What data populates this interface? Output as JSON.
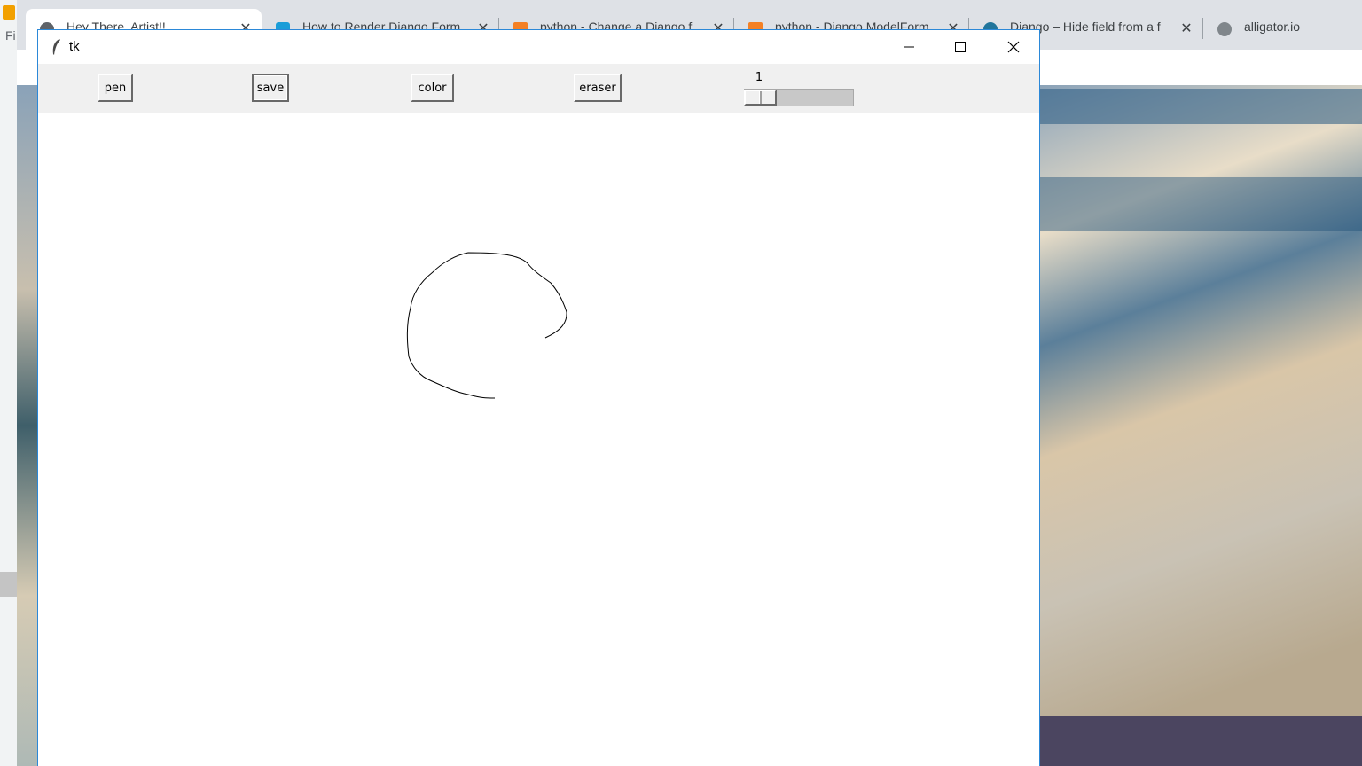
{
  "browser": {
    "left_strip_label": "Fi",
    "tabs": [
      {
        "title": "Hey There, Artist!!",
        "favicon": "globe-icon",
        "active": true
      },
      {
        "title": "How to Render Django Form",
        "favicon": "s-logo-icon",
        "active": false
      },
      {
        "title": "python - Change a Django f",
        "favicon": "stack-overflow-icon",
        "active": false
      },
      {
        "title": "python - Django ModelForm",
        "favicon": "stack-overflow-icon",
        "active": false
      },
      {
        "title": "Django – Hide field from a f",
        "favicon": "wordpress-icon",
        "active": false
      },
      {
        "title": "alligator.io",
        "favicon": "globe-icon",
        "active": false
      }
    ]
  },
  "window": {
    "title": "tk",
    "icon": "tk-feather-icon"
  },
  "toolbar": {
    "pen_label": "pen",
    "save_label": "save",
    "color_label": "color",
    "eraser_label": "eraser",
    "size_value": "1",
    "size_fraction": 0.0
  },
  "canvas": {
    "background": "#ffffff",
    "stroke_color": "#000000",
    "stroke_width": 1
  },
  "colors": {
    "window_border": "#2b88d8",
    "toolbar_bg": "#f0f0f0"
  }
}
